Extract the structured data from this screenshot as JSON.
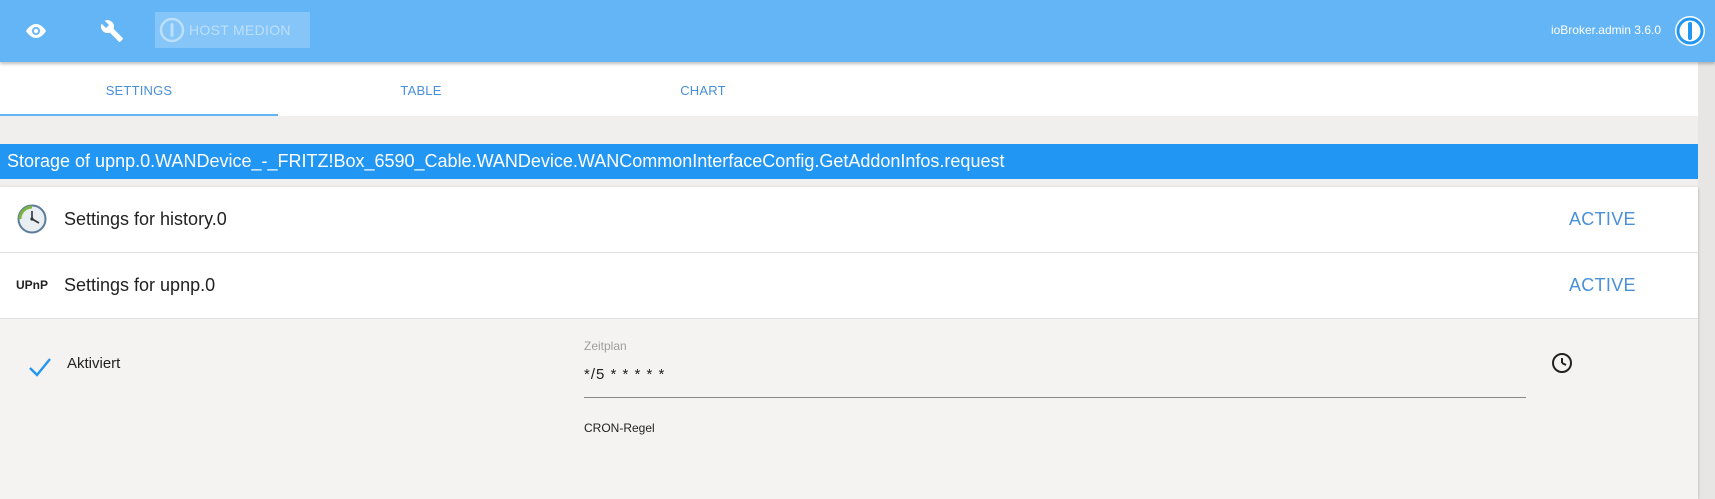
{
  "topbar": {
    "eye_icon": "eye-icon",
    "wrench_icon": "wrench-icon",
    "host_label": "HOST MEDION",
    "version": "ioBroker.admin 3.6.0",
    "background": "#64b5f6"
  },
  "tabs": [
    {
      "label": "SETTINGS",
      "active": true
    },
    {
      "label": "TABLE",
      "active": false
    },
    {
      "label": "CHART",
      "active": false
    }
  ],
  "title": "Storage of upnp.0.WANDevice_-_FRITZ!Box_6590_Cable.WANDevice.WANCommonInterfaceConfig.GetAddonInfos.request",
  "panels": [
    {
      "icon": "history-clock-icon",
      "title": "Settings for history.0",
      "status": "ACTIVE"
    },
    {
      "icon": "upnp-logo-icon",
      "icon_text": "UPnP",
      "title": "Settings for upnp.0",
      "status": "ACTIVE"
    }
  ],
  "detail": {
    "enabled_label": "Aktiviert",
    "enabled": true,
    "schedule_label": "Zeitplan",
    "schedule_value": "*/5 * * * * *",
    "schedule_help": "CRON-Regel"
  },
  "colors": {
    "accent": "#2196f3",
    "link": "#4a90d9",
    "topbar": "#64b5f6"
  }
}
